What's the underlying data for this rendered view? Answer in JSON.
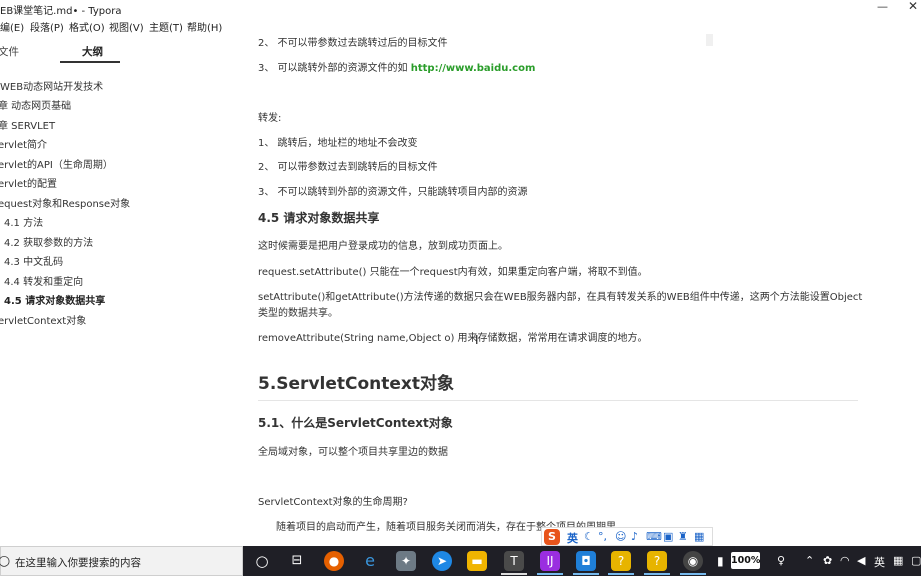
{
  "window": {
    "title": "EB课堂笔记.md• - Typora",
    "minimize_glyph": "—",
    "close_glyph": "✕"
  },
  "menu": [
    "编(E)",
    "段落(P)",
    "格式(O)",
    "视图(V)",
    "主题(T)",
    "帮助(H)"
  ],
  "sidebar": {
    "tabs": [
      "文件",
      "大纲"
    ],
    "outline": [
      "WEB动态网站开发技术",
      "章 动态网页基础",
      "章 SERVLET",
      "ervlet简介",
      "ervlet的API（生命周期）",
      "ervlet的配置",
      "equest对象和Response对象",
      "4.1 方法",
      "4.2 获取参数的方法",
      "4.3 中文乱码",
      "4.4 转发和重定向",
      "4.5 请求对象数据共享",
      "ervletContext对象"
    ]
  },
  "content": {
    "redirect_2": "2、 不可以带参数过去跳转过后的目标文件",
    "redirect_3_prefix": "3、 可以跳转外部的资源文件的如 ",
    "redirect_3_link": "http://www.baidu.com",
    "forward_label": "转发:",
    "forward_1": "1、 跳转后，地址栏的地址不会改变",
    "forward_2": "2、 可以带参数过去到跳转后的目标文件",
    "forward_3": "3、 不可以跳转到外部的资源文件，只能跳转项目内部的资源",
    "h3_45": "4.5 请求对象数据共享",
    "p_login": "这时候需要是把用户登录成功的信息，放到成功页面上。",
    "p_setattr": "request.setAttribute() 只能在一个request内有效，如果重定向客户端，将取不到值。",
    "p_scope_1": "setAttribute()和getAttribute()方法传递的数据只会在WEB服务器内部，在具有转发关系的WEB组件中传递，这两个方法能设置Object",
    "p_scope_2": "类型的数据共享。",
    "p_remove": "removeAttribute(String name,Object o) 用来存储数据，常常用在请求调度的地方。",
    "h2_5": "5.ServletContext对象",
    "h3_51": "5.1、什么是ServletContext对象",
    "p_global": "全局域对象，可以整个项目共享里边的数据",
    "p_lifecycle": "ServletContext对象的生命周期?",
    "p_lifecycle_desc": "随着项目的启动而产生，随着项目服务关闭而消失，存在于整个项目的周期里"
  },
  "ime": {
    "logo": "S",
    "lang": "英"
  },
  "taskbar": {
    "search_placeholder": "在这里输入你要搜索的内容",
    "battery": "100%",
    "tray_lang": "英"
  },
  "colors": {
    "link": "#2a9d2a",
    "taskbar": "#1f1f26",
    "ime_accent": "#1a63c8",
    "ime_logo": "#e8541b"
  }
}
